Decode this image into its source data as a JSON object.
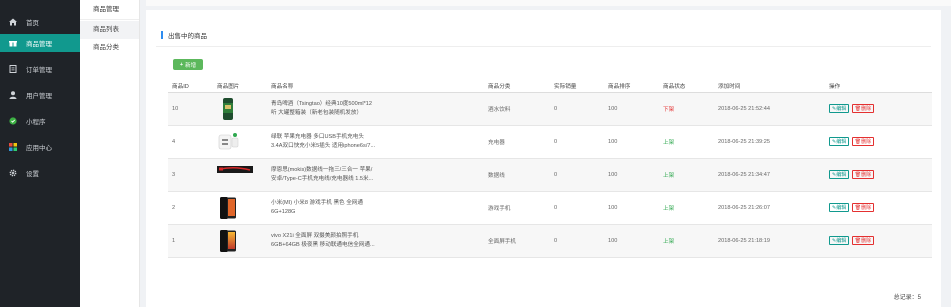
{
  "colors": {
    "sidebar_bg": "#1f2328",
    "accent": "#11998e",
    "add_button": "#5cb85c",
    "status_up": "#2fa84f",
    "status_down": "#e43030"
  },
  "sidebar": {
    "items": [
      {
        "label": "首页",
        "icon": "home-icon"
      },
      {
        "label": "商品管理",
        "icon": "gift-icon",
        "active": true
      },
      {
        "label": "订单管理",
        "icon": "order-icon"
      },
      {
        "label": "用户管理",
        "icon": "user-icon"
      },
      {
        "label": "小程序",
        "icon": "miniprogram-icon"
      },
      {
        "label": "应用中心",
        "icon": "apps-icon"
      },
      {
        "label": "设置",
        "icon": "gear-icon"
      }
    ]
  },
  "subnav": {
    "title": "商品管理",
    "items": [
      {
        "label": "商品列表",
        "active": true
      },
      {
        "label": "商品分类"
      }
    ]
  },
  "main": {
    "section_title": "出售中的商品",
    "add_button": "新增",
    "columns": [
      "商品ID",
      "商品图片",
      "商品名称",
      "商品分类",
      "实际销量",
      "商品排序",
      "商品状态",
      "添加时间",
      "操作"
    ],
    "rows": [
      {
        "id": "10",
        "image": "beer-can",
        "name_line1": "青岛啤酒（Tsingtao）经典10度500ml*12",
        "name_line2": "听 大罐整箱装（新老包装随机发放）",
        "category": "酒水饮料",
        "sales": "0",
        "sort": "100",
        "status": "下架",
        "status_type": "down",
        "time": "2018-06-25 21:52:44",
        "edit": "编辑",
        "delete": "删除"
      },
      {
        "id": "4",
        "image": "charger",
        "name_line1": "绿联 苹果充电器 多口USB手机充电头",
        "name_line2": "3.4A双口快充小米5插头 适用iphone6s/7...",
        "category": "充电器",
        "sales": "0",
        "sort": "100",
        "status": "上架",
        "status_type": "up",
        "time": "2018-06-25 21:39:25",
        "edit": "编辑",
        "delete": "删除"
      },
      {
        "id": "3",
        "image": "cable",
        "name_line1": "摩恩思(mokis)数据线一拖三/三合一 苹果/",
        "name_line2": "安卓/Type-C手机充电线/充电器线 1.5米...",
        "category": "数据线",
        "sales": "0",
        "sort": "100",
        "status": "上架",
        "status_type": "up",
        "time": "2018-06-25 21:34:47",
        "edit": "编辑",
        "delete": "删除"
      },
      {
        "id": "2",
        "image": "phone-dark",
        "name_line1": "小米(MI) 小米8 游戏手机 黑色 全网通",
        "name_line2": "6G+128G",
        "category": "游戏手机",
        "sales": "0",
        "sort": "100",
        "status": "上架",
        "status_type": "up",
        "time": "2018-06-25 21:26:07",
        "edit": "编辑",
        "delete": "删除"
      },
      {
        "id": "1",
        "image": "phone-gradient",
        "name_line1": "vivo X21i 全面屏 双摄美颜拍照手机",
        "name_line2": "6GB+64GB 极夜黑 移动联通电信全网通...",
        "category": "全面屏手机",
        "sales": "0",
        "sort": "100",
        "status": "上架",
        "status_type": "up",
        "time": "2018-06-25 21:18:19",
        "edit": "编辑",
        "delete": "删除"
      }
    ],
    "total": "总记录：5"
  }
}
